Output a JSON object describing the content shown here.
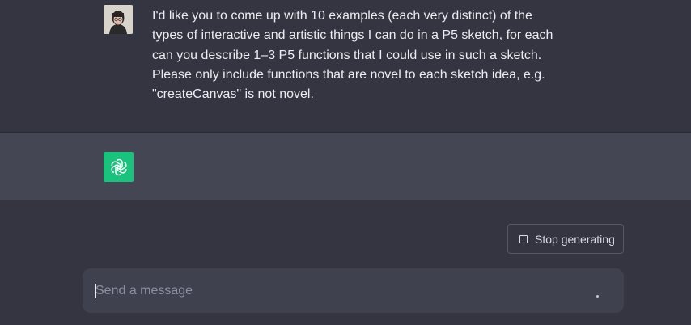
{
  "conversation": {
    "user_message": {
      "avatar": "user-avatar-photo",
      "lines": [
        "I'd like you to come up with 10 examples (each very distinct) of the",
        "types of interactive and artistic things I can do in a P5 sketch, for each",
        "can you describe 1–3 P5 functions that I could use in such a sketch.",
        "Please only include functions that are novel to each sketch idea, e.g.",
        "\"createCanvas\" is not novel."
      ]
    },
    "assistant_message": {
      "avatar": "openai-logo-icon",
      "text": ""
    }
  },
  "controls": {
    "stop_label": "Stop generating",
    "stop_icon": "stop-square-icon"
  },
  "composer": {
    "placeholder": "Send a message",
    "value": "",
    "send_icon": "send-icon"
  },
  "colors": {
    "background": "#343541",
    "assistant_row": "#444654",
    "brand": "#19c37d",
    "input_bg": "#40414f"
  }
}
